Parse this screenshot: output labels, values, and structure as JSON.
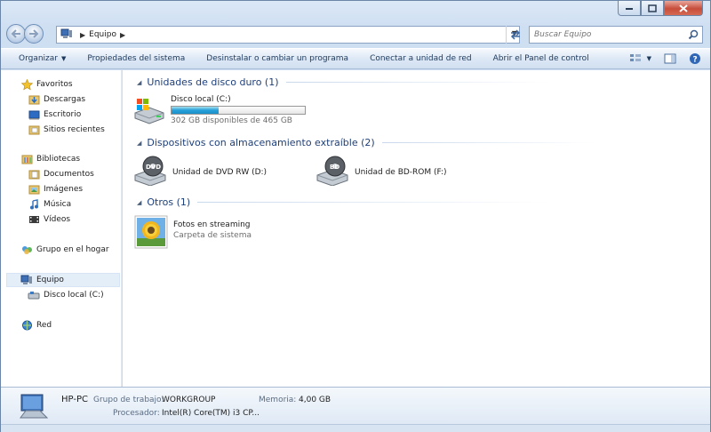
{
  "address": {
    "crumb": "Equipo"
  },
  "search": {
    "placeholder": "Buscar Equipo"
  },
  "toolbar": {
    "items": [
      "Organizar",
      "Propiedades del sistema",
      "Desinstalar o cambiar un programa",
      "Conectar a unidad de red",
      "Abrir el Panel de control"
    ]
  },
  "nav": {
    "favoritos": "Favoritos",
    "descargas": "Descargas",
    "escritorio": "Escritorio",
    "sitios": "Sitios recientes",
    "bibliotecas": "Bibliotecas",
    "documentos": "Documentos",
    "imagenes": "Imágenes",
    "musica": "Música",
    "videos": "Vídeos",
    "grupo": "Grupo en el hogar",
    "equipo": "Equipo",
    "disco": "Disco local (C:)",
    "red": "Red"
  },
  "groups": {
    "hdd": "Unidades de disco duro (1)",
    "removable": "Dispositivos con almacenamiento extraíble (2)",
    "otros": "Otros (1)"
  },
  "items": {
    "disco_label": "Disco local (C:)",
    "disco_free": "302 GB disponibles de 465 GB",
    "disco_used_fraction": 0.35,
    "dvd_label": "Unidad de DVD RW (D:)",
    "bd_label": "Unidad de BD-ROM (F:)",
    "fotos_label": "Fotos en streaming",
    "fotos_sub": "Carpeta de sistema"
  },
  "details": {
    "pc_name": "HP-PC",
    "workgroup_label": "Grupo de trabajo:",
    "workgroup_value": "WORKGROUP",
    "memory_label": "Memoria:",
    "memory_value": "4,00 GB",
    "cpu_label": "Procesador:",
    "cpu_value": "Intel(R) Core(TM) i3 CP..."
  },
  "colors": {
    "accent": "#26a0da",
    "header_text": "#1e3f7a"
  }
}
